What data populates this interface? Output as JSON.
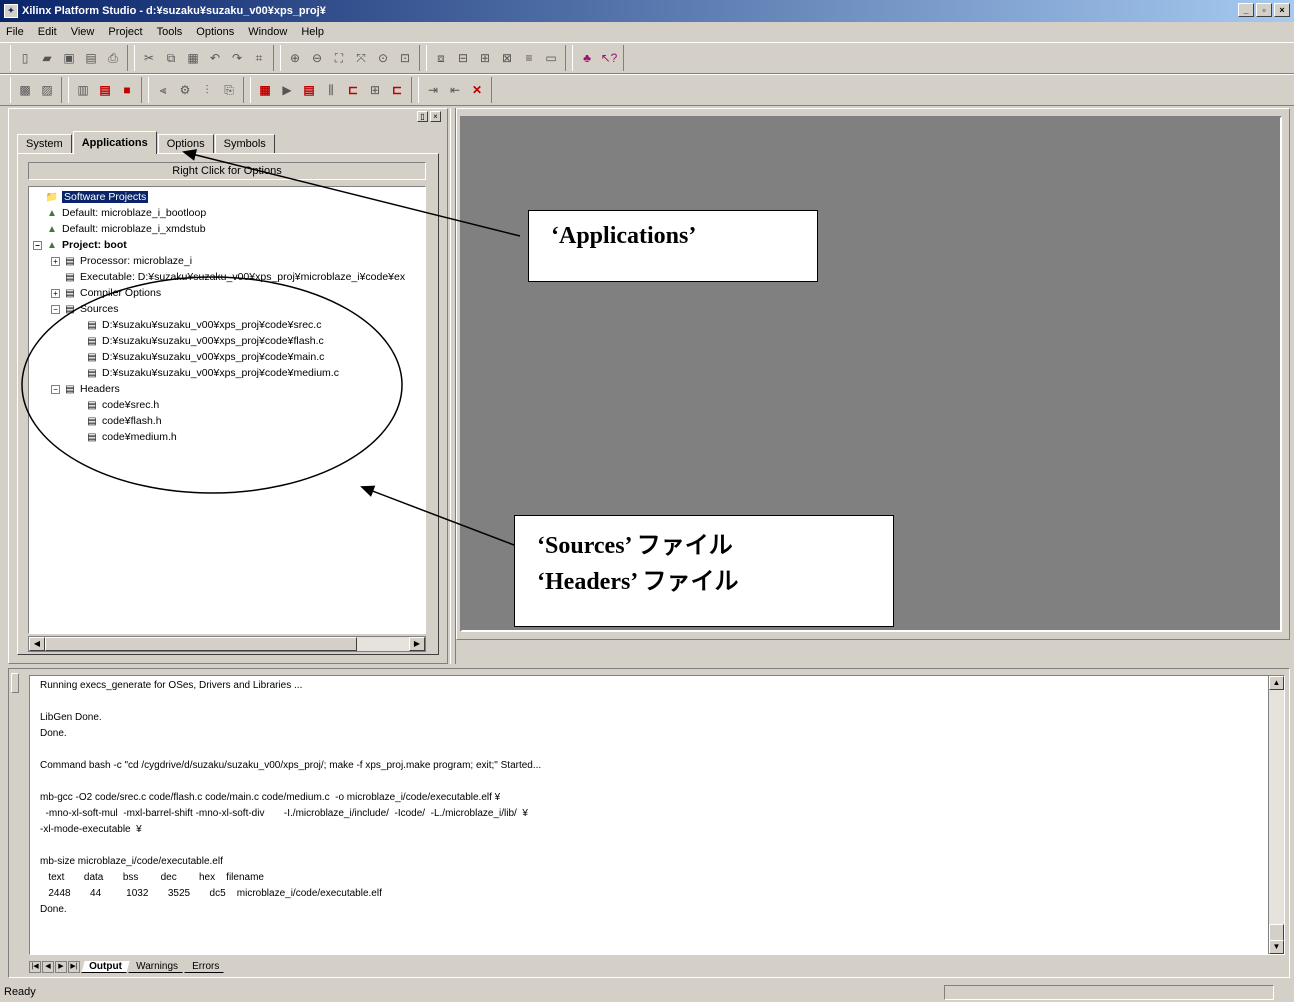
{
  "window": {
    "title": "Xilinx Platform Studio - d:¥suzaku¥suzaku_v00¥xps_proj¥",
    "min": "_",
    "max": "▫",
    "close": "×"
  },
  "menu": [
    "File",
    "Edit",
    "View",
    "Project",
    "Tools",
    "Options",
    "Window",
    "Help"
  ],
  "left_panel": {
    "tabs": [
      "System",
      "Applications",
      "Options",
      "Symbols"
    ],
    "active_tab": "Applications",
    "right_click_hint": "Right Click for Options",
    "tree": [
      {
        "label": "Software Projects",
        "selected": true
      },
      {
        "label": "Default: microblaze_i_bootloop"
      },
      {
        "label": "Default: microblaze_i_xmdstub"
      },
      {
        "label": "Project: boot"
      },
      {
        "label": "Processor: microblaze_i"
      },
      {
        "label": "Executable: D:¥suzaku¥suzaku_v00¥xps_proj¥microblaze_i¥code¥ex"
      },
      {
        "label": "Compiler Options"
      },
      {
        "label": "Sources"
      },
      {
        "label": "D:¥suzaku¥suzaku_v00¥xps_proj¥code¥srec.c"
      },
      {
        "label": "D:¥suzaku¥suzaku_v00¥xps_proj¥code¥flash.c"
      },
      {
        "label": "D:¥suzaku¥suzaku_v00¥xps_proj¥code¥main.c"
      },
      {
        "label": "D:¥suzaku¥suzaku_v00¥xps_proj¥code¥medium.c"
      },
      {
        "label": "Headers"
      },
      {
        "label": "code¥srec.h"
      },
      {
        "label": "code¥flash.h"
      },
      {
        "label": "code¥medium.h"
      }
    ]
  },
  "console": {
    "lines": [
      "Running execs_generate for OSes, Drivers and Libraries ...",
      "LibGen Done.",
      "Done.",
      "Command bash -c \"cd /cygdrive/d/suzaku/suzaku_v00/xps_proj/; make -f xps_proj.make program; exit;\" Started...",
      "mb-gcc -O2 code/srec.c code/flash.c code/main.c code/medium.c  -o microblaze_i/code/executable.elf ¥",
      "  -mno-xl-soft-mul  -mxl-barrel-shift -mno-xl-soft-div       -I./microblaze_i/include/  -Icode/  -L./microblaze_i/lib/  ¥",
      "-xl-mode-executable  ¥",
      "mb-size microblaze_i/code/executable.elf",
      "   text       data       bss        dec        hex    filename",
      "   2448       44         1032       3525       dc5    microblaze_i/code/executable.elf",
      "Done."
    ],
    "tabs": [
      "Output",
      "Warnings",
      "Errors"
    ],
    "active_tab": "Output"
  },
  "status": {
    "text": "Ready"
  },
  "callouts": {
    "applications": "‘Applications’",
    "sources": "‘Sources’ ファイル",
    "headers": "‘Headers’ ファイル"
  }
}
